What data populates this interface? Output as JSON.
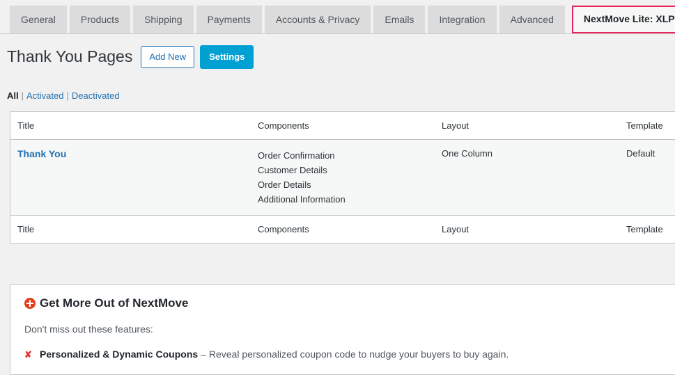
{
  "tabs": [
    {
      "label": "General",
      "active": false
    },
    {
      "label": "Products",
      "active": false
    },
    {
      "label": "Shipping",
      "active": false
    },
    {
      "label": "Payments",
      "active": false
    },
    {
      "label": "Accounts & Privacy",
      "active": false
    },
    {
      "label": "Emails",
      "active": false
    },
    {
      "label": "Integration",
      "active": false
    },
    {
      "label": "Advanced",
      "active": false
    },
    {
      "label": "NextMove Lite: XLPlugins",
      "active": true
    }
  ],
  "header": {
    "title": "Thank You Pages",
    "add_new_label": "Add New",
    "settings_label": "Settings"
  },
  "filters": {
    "all_label": "All",
    "activated_label": "Activated",
    "deactivated_label": "Deactivated",
    "separator": "|"
  },
  "table": {
    "columns": [
      "Title",
      "Components",
      "Layout",
      "Template"
    ],
    "rows": [
      {
        "title": "Thank You",
        "components": [
          "Order Confirmation",
          "Customer Details",
          "Order Details",
          "Additional Information"
        ],
        "layout": "One Column",
        "template": "Default"
      }
    ]
  },
  "promo": {
    "title": "Get More Out of NextMove",
    "subtitle": "Don't miss out these features:",
    "features": [
      {
        "name": "Personalized & Dynamic Coupons",
        "description": "– Reveal personalized coupon code to nudge your buyers to buy again."
      }
    ],
    "bullet_glyph": "✘"
  },
  "colors": {
    "accent_blue": "#2271b1",
    "primary_blue": "#00a0d2",
    "active_tab_border": "#e8245c",
    "plus_icon": "#e2401c",
    "bullet_red": "#dc3232"
  }
}
